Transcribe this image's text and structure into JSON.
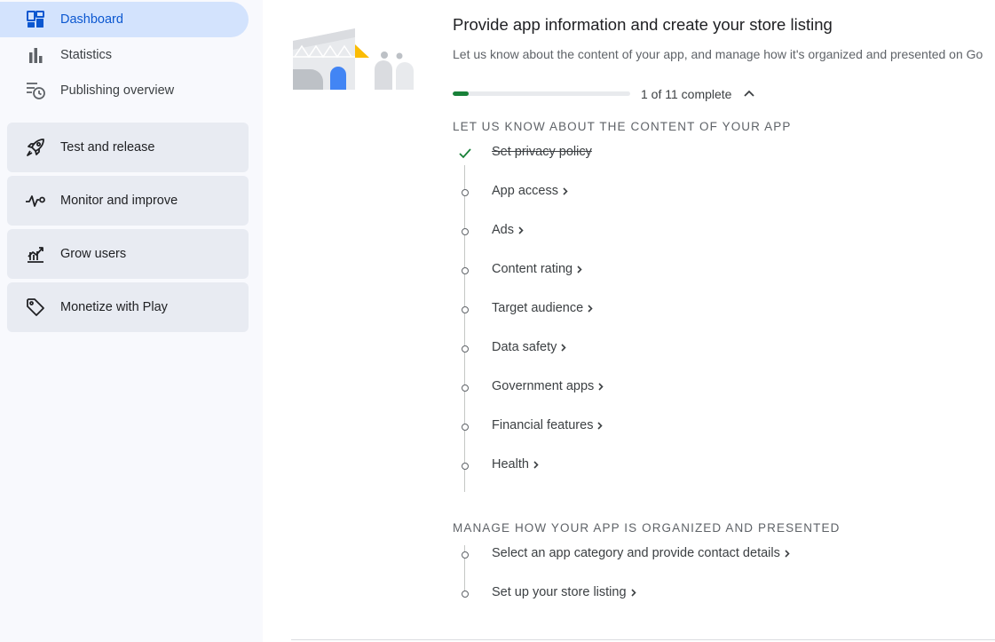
{
  "sidebar": {
    "items": [
      {
        "label": "Dashboard",
        "icon": "dashboard-icon",
        "active": true
      },
      {
        "label": "Statistics",
        "icon": "bar-chart-icon",
        "active": false
      },
      {
        "label": "Publishing overview",
        "icon": "publishing-overview-icon",
        "active": false
      }
    ],
    "groups": [
      {
        "label": "Test and release",
        "icon": "rocket-icon"
      },
      {
        "label": "Monitor and improve",
        "icon": "pulse-icon"
      },
      {
        "label": "Grow users",
        "icon": "growth-chart-icon"
      },
      {
        "label": "Monetize with Play",
        "icon": "tag-icon"
      }
    ]
  },
  "main": {
    "title": "Provide app information and create your store listing",
    "description": "Let us know about the content of your app, and manage how it's organized and presented on Go",
    "progress": {
      "completed": 1,
      "total": 11,
      "text": "1 of 11 complete",
      "fraction": 0.09
    },
    "sections": [
      {
        "heading": "LET US KNOW ABOUT THE CONTENT OF YOUR APP",
        "tasks": [
          {
            "label": "Set privacy policy",
            "done": true
          },
          {
            "label": "App access",
            "done": false
          },
          {
            "label": "Ads",
            "done": false
          },
          {
            "label": "Content rating",
            "done": false
          },
          {
            "label": "Target audience",
            "done": false
          },
          {
            "label": "Data safety",
            "done": false
          },
          {
            "label": "Government apps",
            "done": false
          },
          {
            "label": "Financial features",
            "done": false
          },
          {
            "label": "Health",
            "done": false
          }
        ]
      },
      {
        "heading": "MANAGE HOW YOUR APP IS ORGANIZED AND PRESENTED",
        "tasks": [
          {
            "label": "Select an app category and provide contact details",
            "done": false
          },
          {
            "label": "Set up your store listing",
            "done": false
          }
        ]
      }
    ]
  },
  "colors": {
    "accent": "#0b57d0",
    "active_bg": "#d3e3fd",
    "progress": "#188038",
    "check": "#188038",
    "sidebar_bg": "#f8f9fd",
    "group_bg": "#e8ebf2"
  }
}
